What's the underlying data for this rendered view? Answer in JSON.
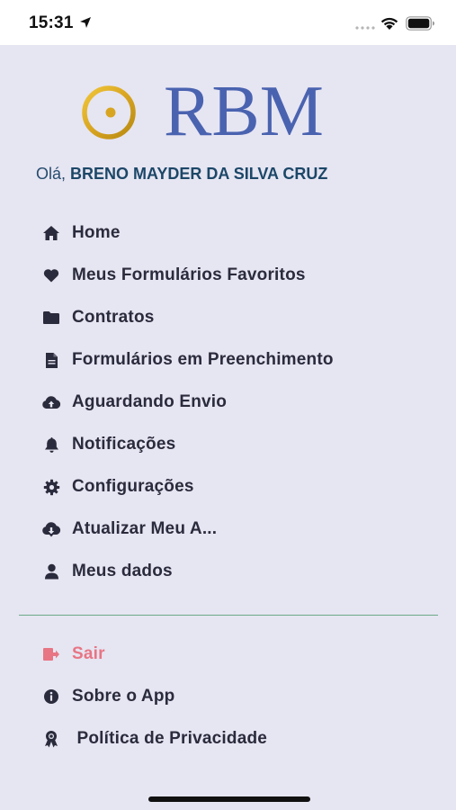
{
  "status_bar": {
    "time": "15:31"
  },
  "logo": {
    "text": "RBM"
  },
  "greeting": {
    "prefix": "Olá,",
    "user_name": "BRENO MAYDER DA SILVA CRUZ"
  },
  "menu": {
    "items": [
      {
        "label": "Home",
        "icon": "home-icon"
      },
      {
        "label": "Meus Formulários Favoritos",
        "icon": "heart-icon"
      },
      {
        "label": "Contratos",
        "icon": "folder-icon"
      },
      {
        "label": "Formulários em Preenchimento",
        "icon": "file-icon"
      },
      {
        "label": "Aguardando Envio",
        "icon": "cloud-upload-icon"
      },
      {
        "label": "Notificações",
        "icon": "bell-icon"
      },
      {
        "label": "Configurações",
        "icon": "gear-icon"
      },
      {
        "label": "Atualizar Meu A...",
        "icon": "cloud-download-icon"
      },
      {
        "label": "Meus dados",
        "icon": "user-icon"
      }
    ],
    "secondary": [
      {
        "label": "Sair",
        "icon": "logout-icon"
      },
      {
        "label": "Sobre o App",
        "icon": "info-icon"
      },
      {
        "label": " Política de Privacidade",
        "icon": "award-icon"
      }
    ]
  },
  "colors": {
    "background": "#e6e5f2",
    "brand_blue": "#4a63b0",
    "brand_gold": "#d8a521",
    "menu_text": "#2a2b3c",
    "logout": "#e87584",
    "divider": "#6bab87"
  }
}
